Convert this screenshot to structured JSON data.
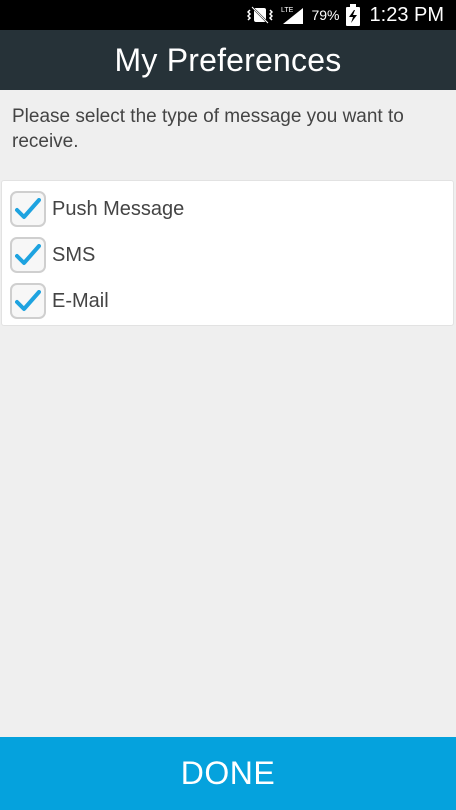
{
  "status_bar": {
    "network_label": "LTE",
    "battery_percent": "79%",
    "time": "1:23 PM",
    "icons": [
      "vibrate-icon",
      "signal-icon",
      "battery-charging-icon"
    ]
  },
  "header": {
    "title": "My Preferences",
    "background": "#263238"
  },
  "instruction": "Please select the type of message you want to receive.",
  "options": [
    {
      "label": "Push Message",
      "checked": true
    },
    {
      "label": "SMS",
      "checked": true
    },
    {
      "label": "E-Mail",
      "checked": true
    }
  ],
  "done_button": {
    "label": "DONE",
    "color": "#05a2dd"
  },
  "colors": {
    "check_mark": "#1ea3e0",
    "page_background": "#efefef"
  }
}
